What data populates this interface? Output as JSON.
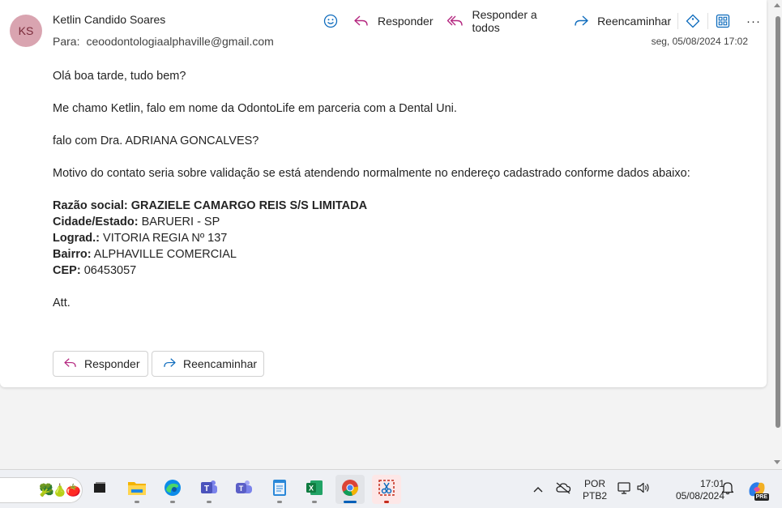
{
  "message": {
    "avatar_initials": "KS",
    "sender_name": "Ketlin Candido Soares",
    "to_label": "Para:",
    "to_address": "ceoodontologiaalphaville@gmail.com",
    "timestamp": "seg, 05/08/2024 17:02",
    "body": {
      "greeting": "Olá boa tarde, tudo bem?",
      "intro": "Me chamo Ketlin, falo em nome da OdontoLife em parceria com a Dental Uni.",
      "ask": "falo com Dra.  ADRIANA GONCALVES?",
      "motive": "Motivo do contato seria sobre validação se está atendendo normalmente no endereço cadastrado conforme dados abaixo:",
      "details": [
        {
          "label": "Razão social:",
          "value": "GRAZIELE CAMARGO REIS S/S LIMITADA",
          "value_bold": true
        },
        {
          "label": "Cidade/Estado:",
          "value": "BARUERI - SP",
          "value_bold": false
        },
        {
          "label": "Lograd.:",
          "value": "VITORIA REGIA Nº 137",
          "value_bold": false
        },
        {
          "label": "Bairro:",
          "value": "ALPHAVILLE COMERCIAL",
          "value_bold": false
        },
        {
          "label": "CEP:",
          "value": "06453057",
          "value_bold": false
        }
      ],
      "signoff": "Att."
    }
  },
  "toolbar": {
    "emoji_icon": "smiley-icon",
    "reply_label": "Responder",
    "reply_all_label": "Responder a todos",
    "forward_label": "Reencaminhar",
    "more_label": "···"
  },
  "actions": {
    "reply_label": "Responder",
    "forward_label": "Reencaminhar"
  },
  "taskbar": {
    "apps": [
      "file-explorer",
      "edge",
      "teams-classic",
      "teams",
      "notepad",
      "excel",
      "chrome",
      "snipping-tool"
    ],
    "language": {
      "line1": "POR",
      "line2": "PTB2"
    },
    "clock": {
      "time": "17:01",
      "date": "05/08/2024"
    },
    "copilot_badge": "PRE"
  },
  "colors": {
    "reply_icon": "#b4267f",
    "forward_icon": "#0f6cbd",
    "avatar_bg": "#d9a4b0",
    "accent": "#0f6cbd"
  }
}
